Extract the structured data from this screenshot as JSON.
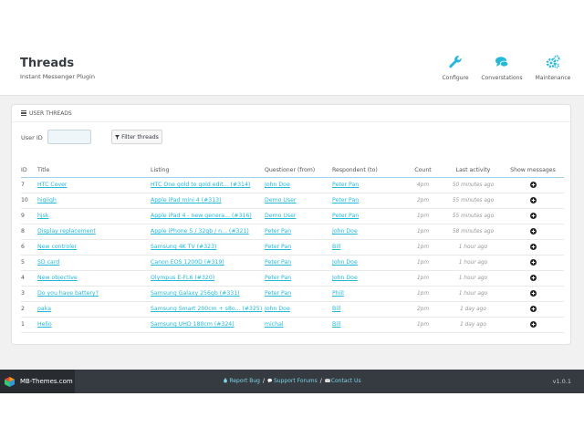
{
  "header": {
    "title": "Threads",
    "subtitle": "Instant Messenger Plugin",
    "toolbar": [
      {
        "label": "Configure",
        "icon": "wrench-icon"
      },
      {
        "label": "Converstations",
        "icon": "comments-icon"
      },
      {
        "label": "Maintenance",
        "icon": "cogs-icon"
      }
    ]
  },
  "panel": {
    "title": "USER THREADS",
    "filter": {
      "label": "User ID",
      "value": "",
      "placeholder": "",
      "button": "Filter threads"
    }
  },
  "table": {
    "headers": [
      "ID",
      "Title",
      "Listing",
      "Questioner (from)",
      "Respondent (to)",
      "Count",
      "Last activity",
      "Show messages"
    ],
    "rows": [
      {
        "id": "7",
        "title": "HTC Cover",
        "listing": "HTC One gold to gold edit... (#314)",
        "from": "John Doe",
        "to": "Peter Pan",
        "count": "4pm",
        "last": "50 minutes ago"
      },
      {
        "id": "10",
        "title": "higiigh",
        "listing": "Apple iPad mini 4 (#313)",
        "from": "Demo User",
        "to": "Peter Pan",
        "count": "2pm",
        "last": "55 minutes ago"
      },
      {
        "id": "9",
        "title": "hjsk",
        "listing": "Apple iPad 4 - new genera... (#316)",
        "from": "Demo User",
        "to": "Peter Pan",
        "count": "1pm",
        "last": "55 minutes ago"
      },
      {
        "id": "8",
        "title": "Display replacement",
        "listing": "Apple iPhone 5 / 32gb / n... (#321)",
        "from": "Peter Pan",
        "to": "John Doe",
        "count": "1pm",
        "last": "58 minutes ago"
      },
      {
        "id": "6",
        "title": "New controler",
        "listing": "Samsung 4K TV (#323)",
        "from": "Peter Pan",
        "to": "Bill",
        "count": "1pm",
        "last": "1 hour ago"
      },
      {
        "id": "5",
        "title": "SD card",
        "listing": "Canon EOS 1200D (#319)",
        "from": "Peter Pan",
        "to": "John Doe",
        "count": "1pm",
        "last": "1 hour ago"
      },
      {
        "id": "4",
        "title": "New objective",
        "listing": "Olympus E-FL6 (#320)",
        "from": "Peter Pan",
        "to": "John Doe",
        "count": "1pm",
        "last": "1 hour ago"
      },
      {
        "id": "3",
        "title": "Do you have battery?",
        "listing": "Samsung Galaxy 256gb (#331)",
        "from": "Peter Pan",
        "to": "Phill",
        "count": "1pm",
        "last": "1 hour ago"
      },
      {
        "id": "2",
        "title": "paka",
        "listing": "Samsung Smart 200cm + s8o... (#325)",
        "from": "John Doe",
        "to": "Bill",
        "count": "2pm",
        "last": "1 day ago"
      },
      {
        "id": "1",
        "title": "Hello",
        "listing": "Samsung UHD 180cm (#324)",
        "from": "michal",
        "to": "Bill",
        "count": "1pm",
        "last": "1 day ago"
      }
    ]
  },
  "footer": {
    "brand": "MB-Themes.com",
    "links": [
      "Report Bug",
      "Support Forums",
      "Contact Us"
    ],
    "separator": "/",
    "version": "v1.0.1"
  },
  "colors": {
    "link": "#25b9d7",
    "footer_bg": "#363a41",
    "accent": "#25b9d7"
  }
}
